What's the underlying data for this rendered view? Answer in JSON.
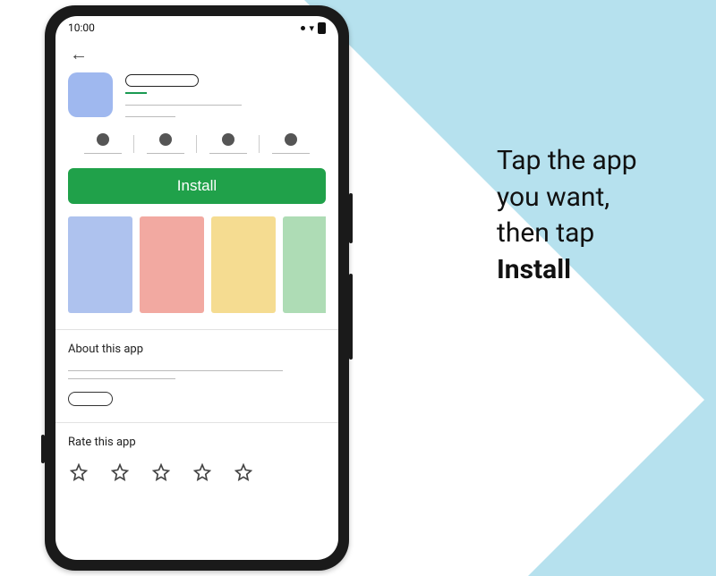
{
  "background": {
    "accent_color": "#b6e1ee"
  },
  "instruction": {
    "line1": "Tap the app",
    "line2": "you want,",
    "line3": "then tap",
    "bold": "Install"
  },
  "status_bar": {
    "time": "10:00",
    "icons": [
      "signal-dot",
      "wifi",
      "battery"
    ]
  },
  "app_detail": {
    "icon_color": "#9fb8ef",
    "title_placeholder": "",
    "developer_placeholder": "",
    "stats_count": 4,
    "install_label": "Install",
    "install_color": "#20a14a",
    "screenshots": [
      {
        "name": "screenshot-1",
        "color": "#aec2ee"
      },
      {
        "name": "screenshot-2",
        "color": "#f2a9a1"
      },
      {
        "name": "screenshot-3",
        "color": "#f5dc91"
      },
      {
        "name": "screenshot-4",
        "color": "#aedcb5"
      }
    ],
    "about_heading": "About this app",
    "rate_heading": "Rate this app",
    "star_count": 5
  }
}
